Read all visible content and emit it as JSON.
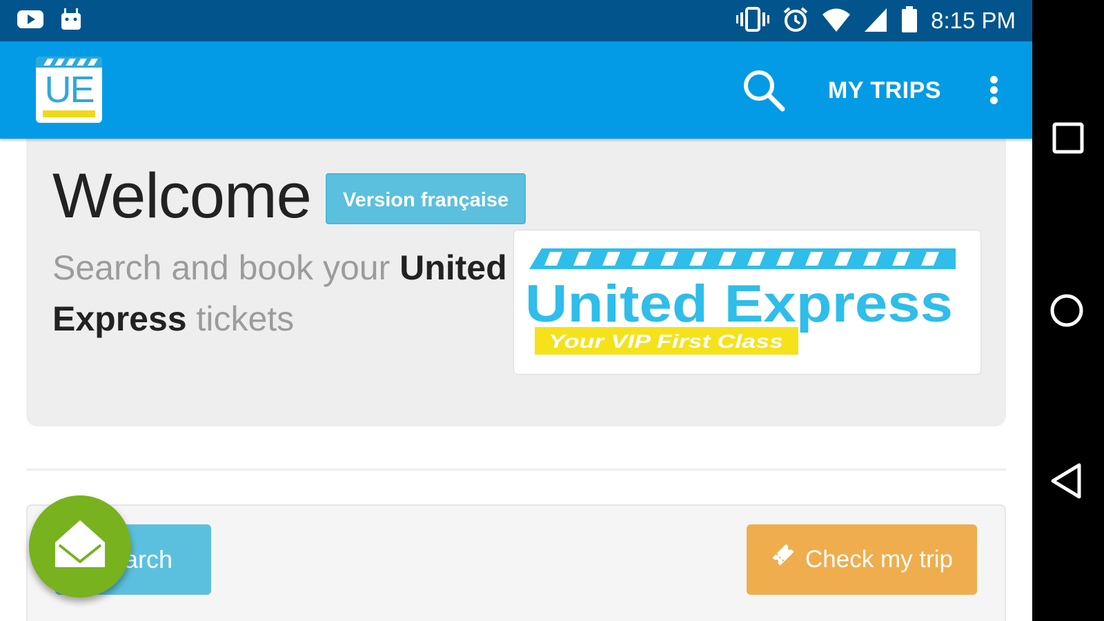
{
  "status_bar": {
    "time": "8:15 PM",
    "left_icons": [
      "youtube-icon",
      "android-icon"
    ],
    "right_icons": [
      "vibrate-icon",
      "alarm-icon",
      "wifi-icon",
      "signal-icon",
      "battery-icon"
    ]
  },
  "app_bar": {
    "logo_text": "UE",
    "my_trips_label": "MY TRIPS",
    "actions": [
      "search-icon",
      "overflow-menu-icon"
    ]
  },
  "jumbotron": {
    "title": "Welcome",
    "french_version_label": "Version française",
    "lead_part1": "Search and book your ",
    "lead_bold": "United Express",
    "lead_part2": " tickets",
    "brand_name": "United Express",
    "brand_tagline": "Your VIP First Class"
  },
  "actions_panel": {
    "search_label": "Search",
    "check_trip_label": "Check my trip"
  },
  "fab": {
    "icon": "open-envelope-icon"
  },
  "nav_bar": {
    "buttons": [
      "recents-icon",
      "home-icon",
      "back-icon"
    ]
  },
  "colors": {
    "status_bar": "#02558c",
    "app_bar": "#039be5",
    "info_button": "#5bc0de",
    "warning_button": "#efad4e",
    "fab": "#78b21e",
    "brand_blue": "#2fbdea",
    "brand_yellow": "#f5e21a"
  }
}
